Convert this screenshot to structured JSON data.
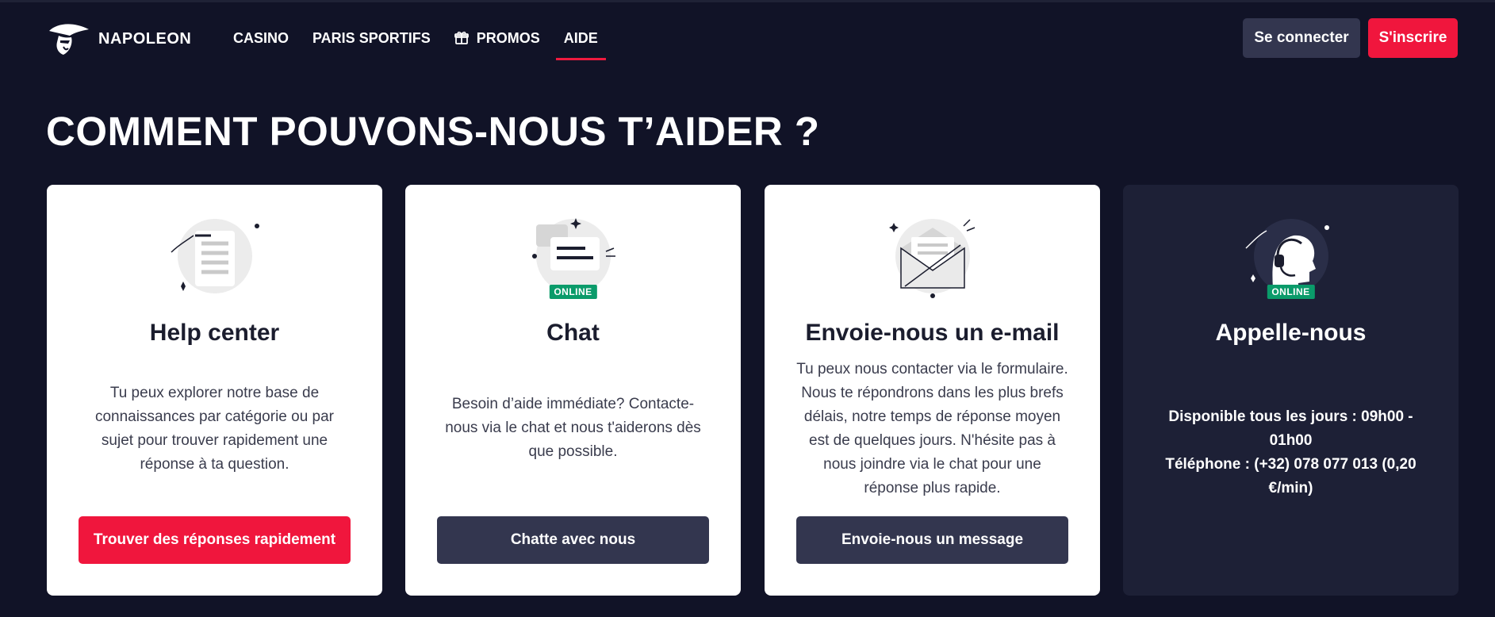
{
  "brand": {
    "name": "NAPOLEON"
  },
  "nav": [
    {
      "label": "CASINO",
      "icon": ""
    },
    {
      "label": "PARIS SPORTIFS",
      "icon": ""
    },
    {
      "label": "PROMOS",
      "icon": "gift-icon"
    },
    {
      "label": "AIDE",
      "icon": "",
      "active": true
    }
  ],
  "auth": {
    "login_label": "Se connecter",
    "signup_label": "S'inscrire"
  },
  "page": {
    "title": "COMMENT POUVONS-NOUS T’AIDER ?"
  },
  "cards": [
    {
      "title": "Help center",
      "description": "Tu peux explorer notre base de connaissances par catégorie ou par sujet pour trouver rapidement une réponse à ta question.",
      "cta": "Trouver des réponses rapidement",
      "illustration": "document-icon"
    },
    {
      "title": "Chat",
      "badge": "ONLINE",
      "description": "Besoin d’aide immédiate? Contacte-nous via le chat et nous t'aiderons dès que possible.",
      "cta": "Chatte avec nous",
      "illustration": "chat-bubble-icon"
    },
    {
      "title": "Envoie-nous un e-mail",
      "description": "Tu peux nous contacter via le formulaire. Nous te répondrons dans les plus brefs délais, notre temps de réponse moyen est de quelques jours. N'hésite pas à nous joindre via le chat pour une réponse plus rapide.",
      "cta": "Envoie-nous un message",
      "illustration": "envelope-icon"
    },
    {
      "title": "Appelle-nous",
      "badge": "ONLINE",
      "description_line1": "Disponible tous les jours : 09h00 - 01h00",
      "description_line2": "Téléphone : (+32) 078 077 013 (0,20 €/min)",
      "illustration": "headset-agent-icon"
    }
  ],
  "colors": {
    "background": "#111327",
    "accent": "#f0163d",
    "button_secondary": "#33364f",
    "online": "#0a9b6a"
  }
}
